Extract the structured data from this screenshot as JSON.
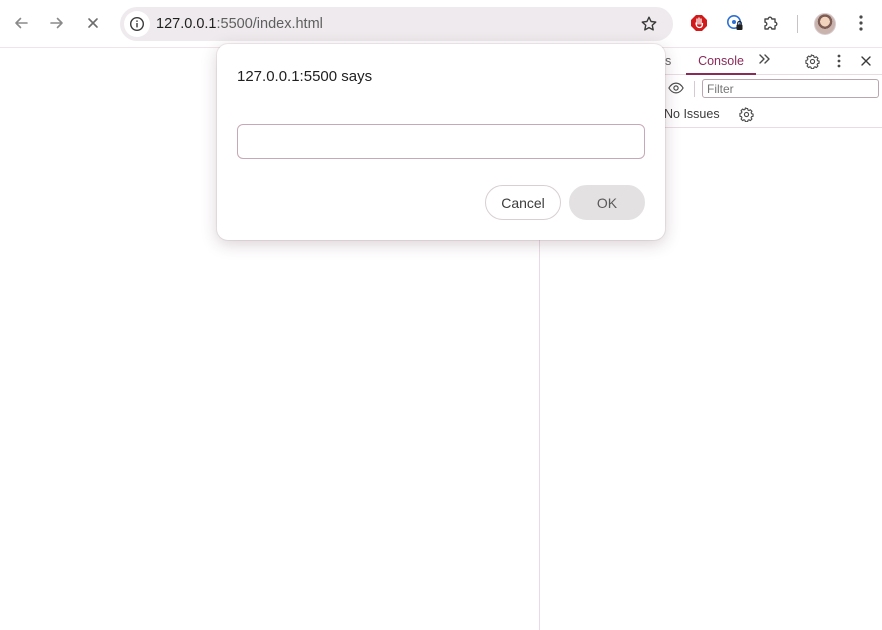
{
  "toolbar": {
    "back_icon": "arrow-left-icon",
    "forward_icon": "arrow-right-icon",
    "stop_icon": "close-icon",
    "url_host": "127.0.0.1",
    "url_rest": ":5500/index.html",
    "bookmark_icon": "star-icon",
    "extensions": [
      "stop-extension-icon",
      "password-lock-icon",
      "puzzle-icon"
    ],
    "menu_icon": "kebab-menu-icon"
  },
  "devtools": {
    "tab_partial": "s",
    "tab_console": "Console",
    "more_tabs": "»",
    "filter_placeholder": "Filter",
    "issues_label": "No Issues"
  },
  "dialog": {
    "title": "127.0.0.1:5500 says",
    "input_value": "",
    "cancel_label": "Cancel",
    "ok_label": "OK"
  },
  "colors": {
    "accent": "#8a2a59",
    "omnibox_bg": "#eeeaed",
    "ok_button_bg": "#e4e1e3"
  }
}
